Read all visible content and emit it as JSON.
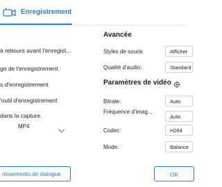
{
  "tab": {
    "label": "Enregistrement",
    "icon": "video-camera-icon",
    "accent": "#1e7fe0"
  },
  "left_options": [
    "à rebours avant l'enregist...",
    "ge de l'enregistrement",
    "s d'enregistrement",
    "'outil d'enregistrement",
    "dans la capture."
  ],
  "format": {
    "value": "MP4",
    "icon": "chevron-down-icon"
  },
  "advanced": {
    "title": "Avancée",
    "rows": [
      {
        "label": "Styles de souris",
        "value": "Afficher"
      },
      {
        "label": "Qualité d'audio:",
        "value": "Standard"
      }
    ]
  },
  "video": {
    "title": "Paramètres de vidéo",
    "icon": "gear-icon",
    "rows": [
      {
        "label": "Bitrate:",
        "value": "Auto"
      },
      {
        "label": "Fréquence d'imag...",
        "value": "Auto"
      },
      {
        "label": "Codec:",
        "value": "H264"
      },
      {
        "label": "Mode:",
        "value": "Balance"
      }
    ]
  },
  "buttons": {
    "dialog": "rtissements de dialogue",
    "ok": "OK"
  }
}
